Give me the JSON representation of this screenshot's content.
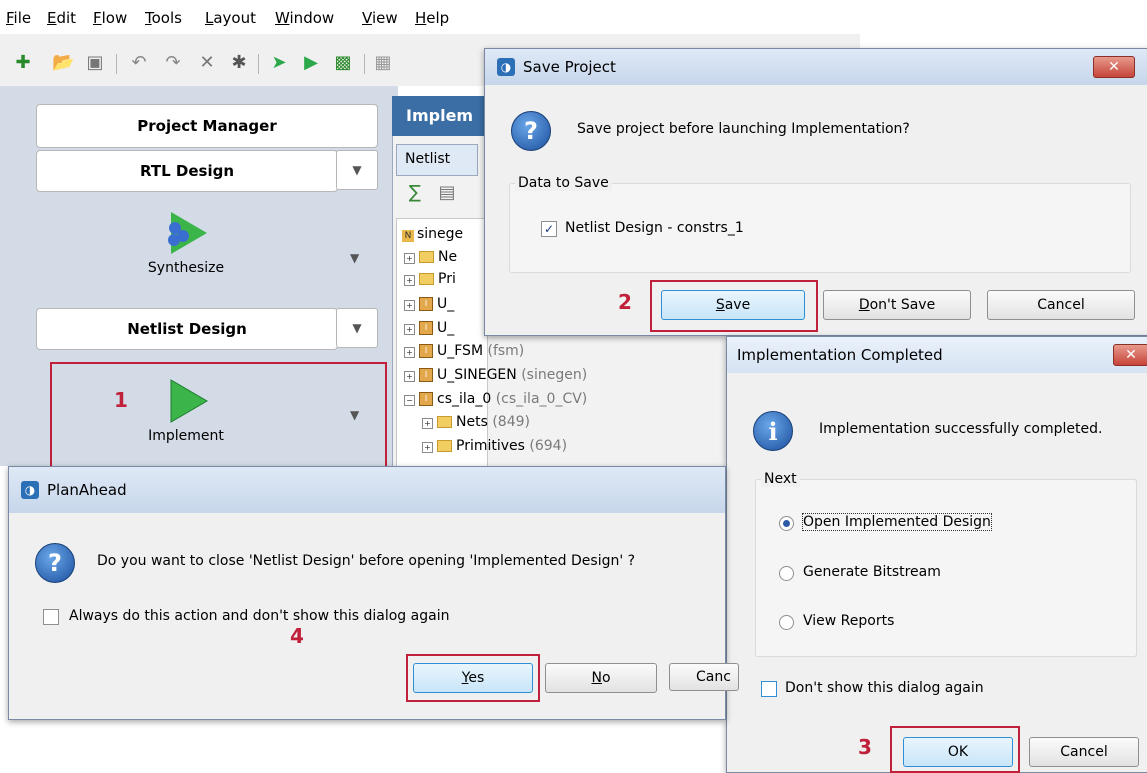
{
  "menu": [
    "File",
    "Edit",
    "Flow",
    "Tools",
    "Layout",
    "Window",
    "View",
    "Help"
  ],
  "flow_nav": {
    "project_manager": "Project Manager",
    "rtl_design": "RTL Design",
    "synthesize": "Synthesize",
    "netlist_design": "Netlist Design",
    "implement": "Implement"
  },
  "impl_panel": {
    "title": "Implem",
    "tab": "Netlist",
    "tree": [
      {
        "name": "sinege",
        "detail": ""
      },
      {
        "name": "Ne",
        "detail": ""
      },
      {
        "name": "Pri",
        "detail": ""
      },
      {
        "name": "U_",
        "detail": ""
      },
      {
        "name": "U_",
        "detail": ""
      },
      {
        "name": "U_FSM",
        "detail": "(fsm)"
      },
      {
        "name": "U_SINEGEN",
        "detail": "(sinegen)"
      },
      {
        "name": "cs_ila_0",
        "detail": "(cs_ila_0_CV)"
      },
      {
        "name": "Nets",
        "detail": "(849)"
      },
      {
        "name": "Primitives",
        "detail": "(694)"
      }
    ]
  },
  "save_dialog": {
    "title": "Save Project",
    "message": "Save project before launching Implementation?",
    "group_label": "Data to Save",
    "checkbox_label": "Netlist Design - constrs_1",
    "buttons": {
      "save": "Save",
      "dont_save": "Don't Save",
      "cancel": "Cancel"
    }
  },
  "impl_dialog": {
    "title": "Implementation Completed",
    "message": "Implementation successfully completed.",
    "group_label": "Next",
    "options": [
      "Open Implemented Design",
      "Generate Bitstream",
      "View Reports"
    ],
    "checkbox_label": "Don't show this dialog again",
    "buttons": {
      "ok": "OK",
      "cancel": "Cancel"
    }
  },
  "planahead_dialog": {
    "title": "PlanAhead",
    "message": "Do you want to close 'Netlist Design' before opening 'Implemented Design' ?",
    "checkbox_label": "Always do this action and don't show this dialog again",
    "buttons": {
      "yes": "Yes",
      "no": "No",
      "cancel": "Canc"
    }
  },
  "steps": {
    "one": "1",
    "two": "2",
    "three": "3",
    "four": "4"
  },
  "colors": {
    "callout": "#c0203a",
    "title_bar": "#3a6ea5"
  }
}
